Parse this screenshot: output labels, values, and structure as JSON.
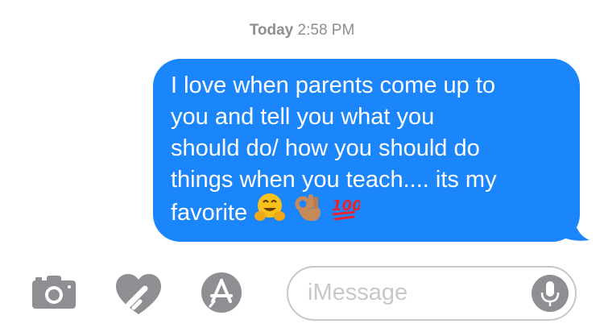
{
  "timestamp": {
    "day": "Today",
    "time": "2:58 PM"
  },
  "message": {
    "lines": [
      "I love when parents come up to",
      "you and tell you what you",
      "should do/ how you should do",
      "things when you teach.... its my"
    ],
    "last_line_text": "favorite",
    "emojis": [
      "hugging-face-icon",
      "ok-hand-icon",
      "hundred-points-icon"
    ],
    "bubble_color": "#1b86fb",
    "text_color": "#ffffff"
  },
  "toolbar": {
    "icons": [
      "camera-icon",
      "digital-touch-heart-icon",
      "app-store-icon",
      "microphone-icon"
    ],
    "input_placeholder": "iMessage",
    "icon_color": "#8e8e93"
  }
}
